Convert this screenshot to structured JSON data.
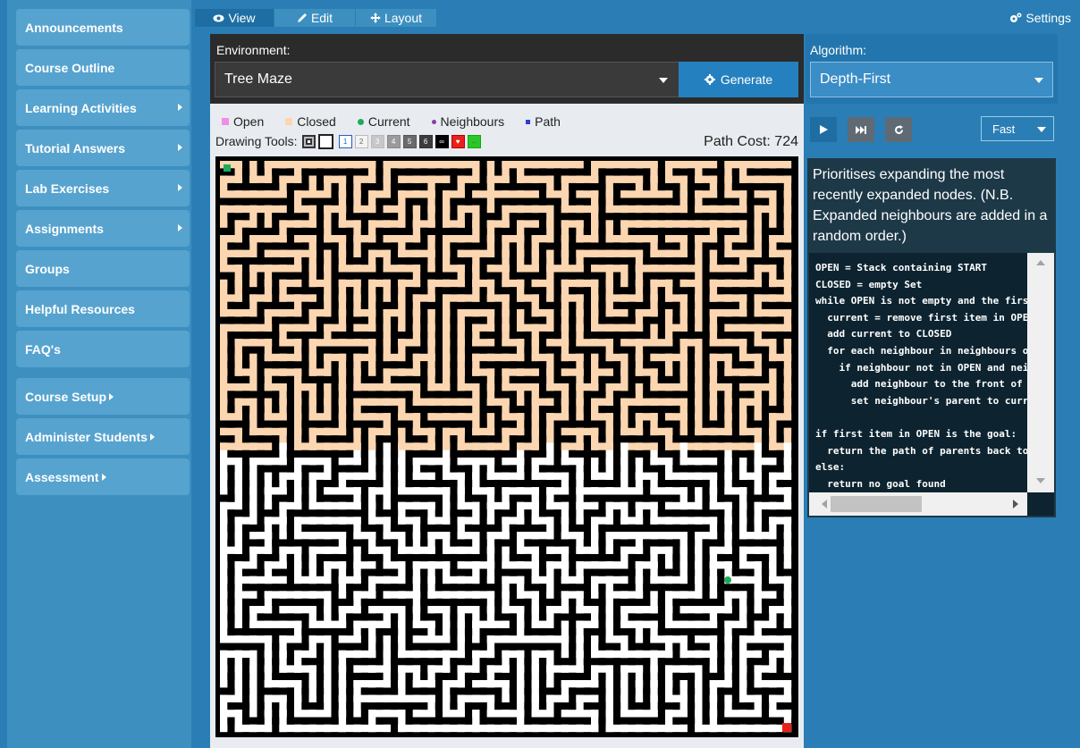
{
  "sidebar": {
    "items": [
      {
        "label": "Announcements",
        "submenu": false
      },
      {
        "label": "Course Outline",
        "submenu": false
      },
      {
        "label": "Learning Activities",
        "submenu": true
      },
      {
        "label": "Tutorial Answers",
        "submenu": true
      },
      {
        "label": "Lab Exercises",
        "submenu": true
      },
      {
        "label": "Assignments",
        "submenu": true
      },
      {
        "label": "Groups",
        "submenu": false
      },
      {
        "label": "Helpful Resources",
        "submenu": false
      },
      {
        "label": "FAQ's",
        "submenu": false
      }
    ],
    "admin_items": [
      {
        "label": "Course Setup"
      },
      {
        "label": "Administer Students"
      },
      {
        "label": "Assessment"
      }
    ]
  },
  "toolbar": {
    "view_label": "View",
    "edit_label": "Edit",
    "layout_label": "Layout",
    "settings_label": "Settings"
  },
  "environment": {
    "label": "Environment:",
    "selected": "Tree Maze",
    "generate_label": "Generate"
  },
  "legend": {
    "open": "Open",
    "closed": "Closed",
    "current": "Current",
    "neighbours": "Neighbours",
    "path": "Path"
  },
  "tools": {
    "label": "Drawing Tools:",
    "weights": [
      "1",
      "2",
      "3",
      "4",
      "5",
      "6"
    ]
  },
  "path_cost": "Path Cost: 724",
  "algorithm": {
    "label": "Algorithm:",
    "selected": "Depth-First",
    "speed": "Fast",
    "description": "Prioritises expanding the most recently expanded nodes. (N.B. Expanded neighbours are added in a random order.)",
    "code": "OPEN = Stack containing START\nCLOSED = empty Set\nwhile OPEN is not empty and the first item in OPEN is not the goal:\n  current = remove first item in OPEN\n  add current to CLOSED\n  for each neighbour in neighbours of current:\n    if neighbour not in OPEN and neighbour not in CLOSED:\n      add neighbour to the front of OPEN\n      set neighbour's parent to current\n\nif first item in OPEN is the goal:\n  return the path of parents back to START\nelse:\n  return no goal found"
  },
  "colors": {
    "open": "#f08de6",
    "closed": "#fcd6b0",
    "current": "#1faa5a",
    "neighbours": "#8e3aa8",
    "path": "#2b3fd6",
    "wall": "#000000",
    "floor": "#ffffff",
    "goal": "#e8221a",
    "start": "#1faa5a"
  }
}
